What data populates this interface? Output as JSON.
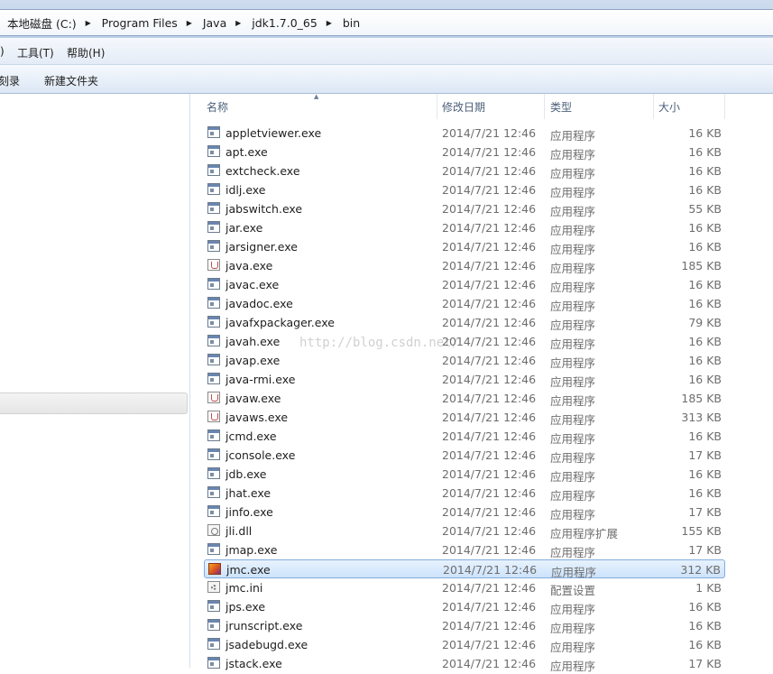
{
  "breadcrumbs": [
    "本地磁盘 (C:)",
    "Program Files",
    "Java",
    "jdk1.7.0_65",
    "bin"
  ],
  "menu": {
    "partial_first": ")",
    "tools": "工具(T)",
    "help": "帮助(H)"
  },
  "commands": {
    "partial_first": "刻录",
    "new_folder": "新建文件夹"
  },
  "columns": {
    "name": "名称",
    "date": "修改日期",
    "type": "类型",
    "size": "大小"
  },
  "watermark": "http://blog.csdn.net/",
  "files": [
    {
      "name": "appletviewer.exe",
      "date": "2014/7/21 12:46",
      "type": "应用程序",
      "size": "16 KB",
      "icon": "exe"
    },
    {
      "name": "apt.exe",
      "date": "2014/7/21 12:46",
      "type": "应用程序",
      "size": "16 KB",
      "icon": "exe"
    },
    {
      "name": "extcheck.exe",
      "date": "2014/7/21 12:46",
      "type": "应用程序",
      "size": "16 KB",
      "icon": "exe"
    },
    {
      "name": "idlj.exe",
      "date": "2014/7/21 12:46",
      "type": "应用程序",
      "size": "16 KB",
      "icon": "exe"
    },
    {
      "name": "jabswitch.exe",
      "date": "2014/7/21 12:46",
      "type": "应用程序",
      "size": "55 KB",
      "icon": "exe"
    },
    {
      "name": "jar.exe",
      "date": "2014/7/21 12:46",
      "type": "应用程序",
      "size": "16 KB",
      "icon": "exe"
    },
    {
      "name": "jarsigner.exe",
      "date": "2014/7/21 12:46",
      "type": "应用程序",
      "size": "16 KB",
      "icon": "exe"
    },
    {
      "name": "java.exe",
      "date": "2014/7/21 12:46",
      "type": "应用程序",
      "size": "185 KB",
      "icon": "java"
    },
    {
      "name": "javac.exe",
      "date": "2014/7/21 12:46",
      "type": "应用程序",
      "size": "16 KB",
      "icon": "exe"
    },
    {
      "name": "javadoc.exe",
      "date": "2014/7/21 12:46",
      "type": "应用程序",
      "size": "16 KB",
      "icon": "exe"
    },
    {
      "name": "javafxpackager.exe",
      "date": "2014/7/21 12:46",
      "type": "应用程序",
      "size": "79 KB",
      "icon": "exe"
    },
    {
      "name": "javah.exe",
      "date": "2014/7/21 12:46",
      "type": "应用程序",
      "size": "16 KB",
      "icon": "exe"
    },
    {
      "name": "javap.exe",
      "date": "2014/7/21 12:46",
      "type": "应用程序",
      "size": "16 KB",
      "icon": "exe"
    },
    {
      "name": "java-rmi.exe",
      "date": "2014/7/21 12:46",
      "type": "应用程序",
      "size": "16 KB",
      "icon": "exe"
    },
    {
      "name": "javaw.exe",
      "date": "2014/7/21 12:46",
      "type": "应用程序",
      "size": "185 KB",
      "icon": "java"
    },
    {
      "name": "javaws.exe",
      "date": "2014/7/21 12:46",
      "type": "应用程序",
      "size": "313 KB",
      "icon": "java"
    },
    {
      "name": "jcmd.exe",
      "date": "2014/7/21 12:46",
      "type": "应用程序",
      "size": "16 KB",
      "icon": "exe"
    },
    {
      "name": "jconsole.exe",
      "date": "2014/7/21 12:46",
      "type": "应用程序",
      "size": "17 KB",
      "icon": "exe"
    },
    {
      "name": "jdb.exe",
      "date": "2014/7/21 12:46",
      "type": "应用程序",
      "size": "16 KB",
      "icon": "exe"
    },
    {
      "name": "jhat.exe",
      "date": "2014/7/21 12:46",
      "type": "应用程序",
      "size": "16 KB",
      "icon": "exe"
    },
    {
      "name": "jinfo.exe",
      "date": "2014/7/21 12:46",
      "type": "应用程序",
      "size": "17 KB",
      "icon": "exe"
    },
    {
      "name": "jli.dll",
      "date": "2014/7/21 12:46",
      "type": "应用程序扩展",
      "size": "155 KB",
      "icon": "dll"
    },
    {
      "name": "jmap.exe",
      "date": "2014/7/21 12:46",
      "type": "应用程序",
      "size": "17 KB",
      "icon": "exe"
    },
    {
      "name": "jmc.exe",
      "date": "2014/7/21 12:46",
      "type": "应用程序",
      "size": "312 KB",
      "icon": "jmc",
      "selected": true
    },
    {
      "name": "jmc.ini",
      "date": "2014/7/21 12:46",
      "type": "配置设置",
      "size": "1 KB",
      "icon": "ini"
    },
    {
      "name": "jps.exe",
      "date": "2014/7/21 12:46",
      "type": "应用程序",
      "size": "16 KB",
      "icon": "exe"
    },
    {
      "name": "jrunscript.exe",
      "date": "2014/7/21 12:46",
      "type": "应用程序",
      "size": "16 KB",
      "icon": "exe"
    },
    {
      "name": "jsadebugd.exe",
      "date": "2014/7/21 12:46",
      "type": "应用程序",
      "size": "16 KB",
      "icon": "exe"
    },
    {
      "name": "jstack.exe",
      "date": "2014/7/21 12:46",
      "type": "应用程序",
      "size": "17 KB",
      "icon": "exe"
    }
  ]
}
